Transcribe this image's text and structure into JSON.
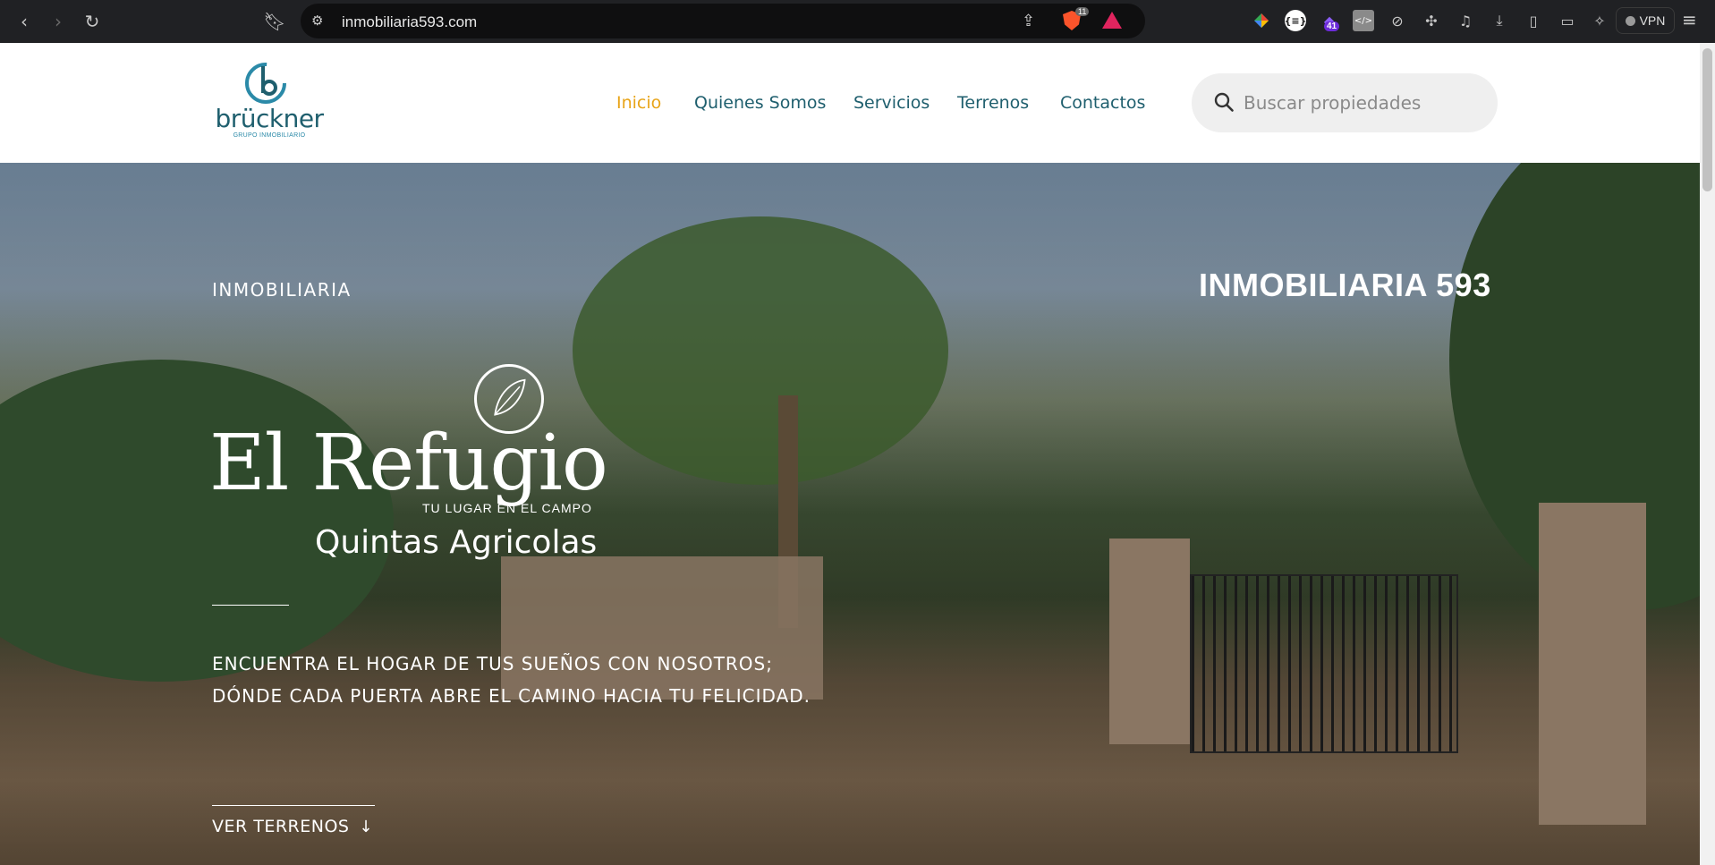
{
  "browser": {
    "url": "inmobiliaria593.com",
    "shield_count": "11",
    "extension_badge": "41",
    "vpn_label": "VPN",
    "icons": [
      "back-icon",
      "forward-icon",
      "reload-icon",
      "bookmark-icon",
      "site-settings-icon",
      "share-icon",
      "brave-shield-icon",
      "brave-rewards-icon",
      "color-picker-icon",
      "json-viewer-icon",
      "extension-badge-icon",
      "dev-tools-icon",
      "compass-icon",
      "puzzle-icon",
      "music-icon",
      "download-icon",
      "sidebar-icon",
      "wallet-icon",
      "leo-icon",
      "menu-icon"
    ]
  },
  "site": {
    "logo": {
      "name": "brückner",
      "subtitle": "GRUPO INMOBILIARIO"
    },
    "nav": [
      {
        "label": "Inicio",
        "active": true
      },
      {
        "label": "Quienes Somos",
        "active": false
      },
      {
        "label": "Servicios",
        "active": false
      },
      {
        "label": "Terrenos",
        "active": false
      },
      {
        "label": "Contactos",
        "active": false
      }
    ],
    "search": {
      "placeholder": "Buscar propiedades"
    },
    "colors": {
      "nav_text": "#1f5f6e",
      "nav_active": "#e8a418"
    }
  },
  "hero": {
    "eyebrow": "INMOBILIARIA",
    "brand": "INMOBILIARIA 593",
    "project_title": "El Refugio",
    "project_tag": "TU LUGAR EN EL CAMPO",
    "project_subtitle": "Quintas Agricolas",
    "tagline_line1": "ENCUENTRA EL HOGAR DE TUS SUEÑOS CON NOSOTROS;",
    "tagline_line2": "DÓNDE CADA PUERTA ABRE EL CAMINO HACIA TU FELICIDAD.",
    "cta_label": "VER TERRENOS",
    "cta_arrow": "↓"
  }
}
